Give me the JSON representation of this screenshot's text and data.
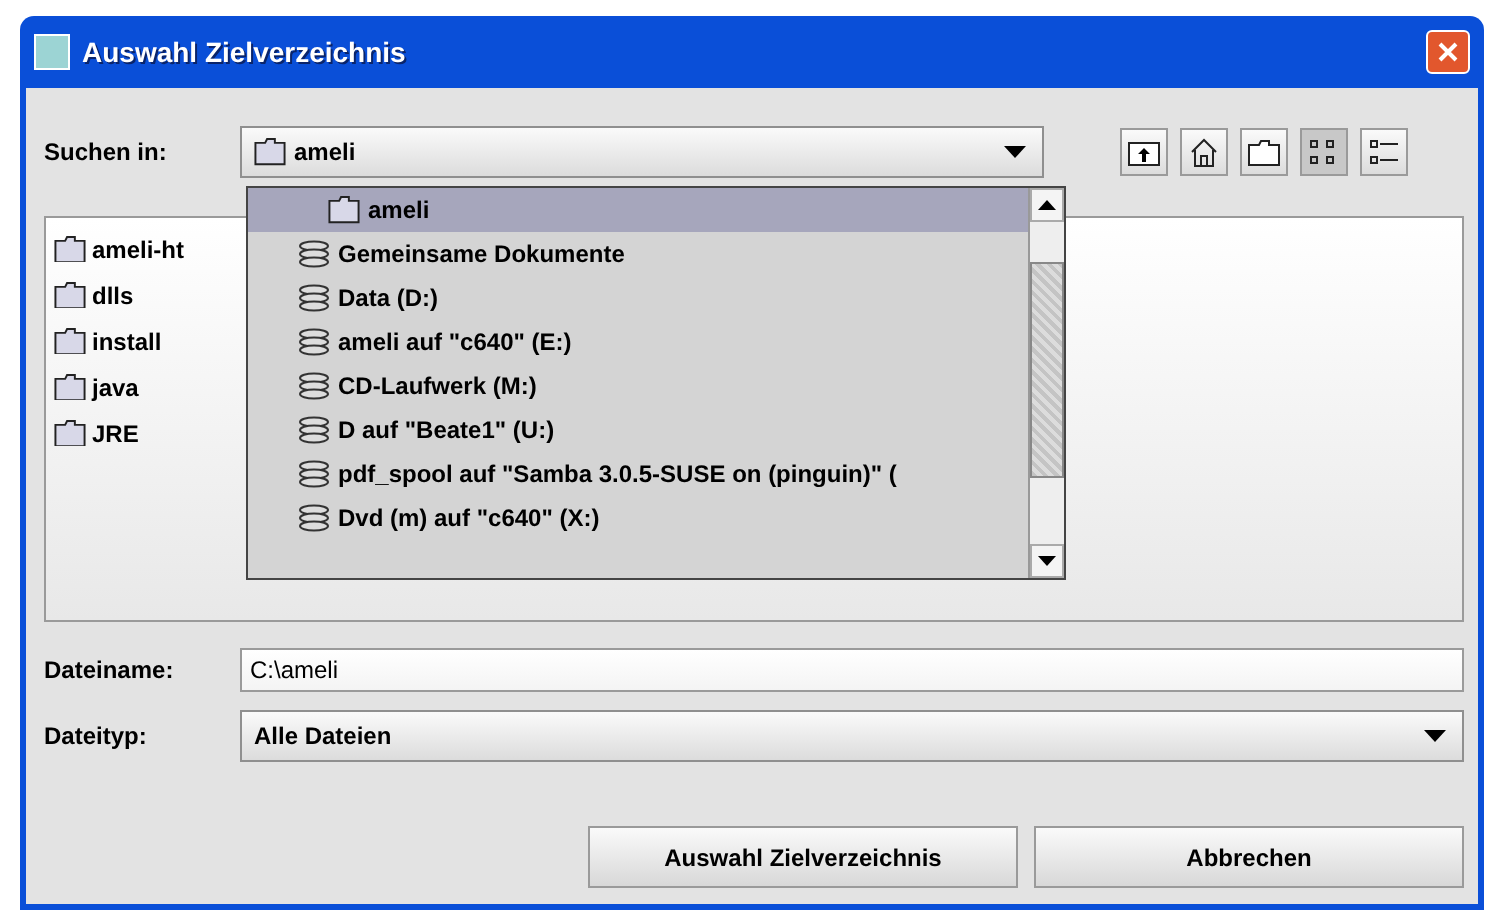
{
  "window": {
    "title": "Auswahl Zielverzeichnis"
  },
  "look_in": {
    "label": "Suchen in:",
    "value": "ameli"
  },
  "toolbar": [
    {
      "kind": "up",
      "selected": false
    },
    {
      "kind": "home",
      "selected": false
    },
    {
      "kind": "newfolder",
      "selected": false
    },
    {
      "kind": "list",
      "selected": true
    },
    {
      "kind": "details",
      "selected": false
    }
  ],
  "files": [
    {
      "name": "ameli-ht"
    },
    {
      "name": "dlls"
    },
    {
      "name": "install"
    },
    {
      "name": "java"
    },
    {
      "name": "JRE"
    }
  ],
  "popup": [
    {
      "kind": "folder",
      "label": "ameli",
      "selected": true
    },
    {
      "kind": "drive",
      "label": "Gemeinsame Dokumente",
      "selected": false
    },
    {
      "kind": "drive",
      "label": "Data (D:)",
      "selected": false
    },
    {
      "kind": "drive",
      "label": "ameli auf \"c640\" (E:)",
      "selected": false
    },
    {
      "kind": "drive",
      "label": "CD-Laufwerk (M:)",
      "selected": false
    },
    {
      "kind": "drive",
      "label": "D auf \"Beate1\" (U:)",
      "selected": false
    },
    {
      "kind": "drive",
      "label": "pdf_spool auf \"Samba 3.0.5-SUSE on (pinguin)\" (",
      "selected": false
    },
    {
      "kind": "drive",
      "label": "Dvd (m) auf \"c640\" (X:)",
      "selected": false
    }
  ],
  "filename": {
    "label": "Dateiname:",
    "value": "C:\\ameli"
  },
  "filetype": {
    "label": "Dateityp:",
    "value": "Alle Dateien"
  },
  "buttons": [
    "Auswahl Zielverzeichnis",
    "Abbrechen"
  ]
}
